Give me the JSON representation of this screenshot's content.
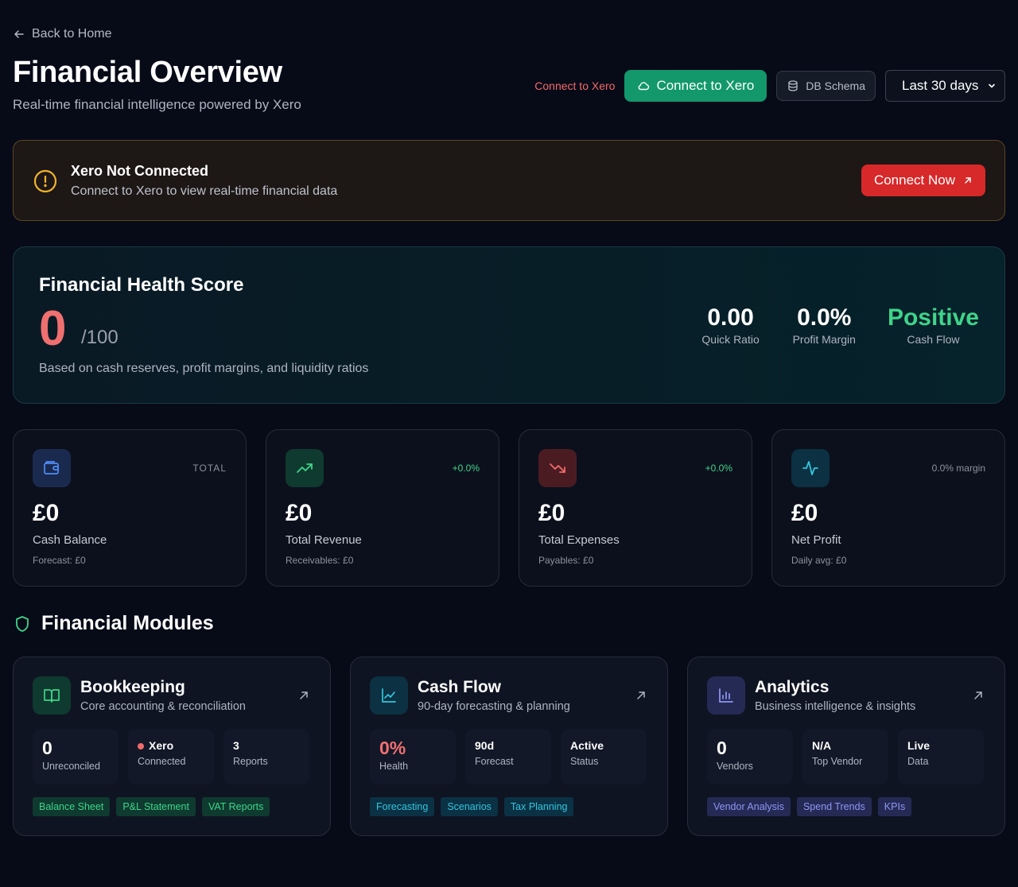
{
  "header": {
    "back_label": "Back to Home",
    "title": "Financial Overview",
    "subtitle": "Real-time financial intelligence powered by Xero",
    "connect_text": "Connect to Xero",
    "connect_button": "Connect to Xero",
    "schema_button": "DB Schema",
    "date_range": "Last 30 days"
  },
  "alert": {
    "title": "Xero Not Connected",
    "text": "Connect to Xero to view real-time financial data",
    "button": "Connect Now"
  },
  "health": {
    "title": "Financial Health Score",
    "score": "0",
    "max": "/100",
    "description": "Based on cash reserves, profit margins, and liquidity ratios",
    "metrics": [
      {
        "value": "0.00",
        "label": "Quick Ratio"
      },
      {
        "value": "0.0%",
        "label": "Profit Margin"
      },
      {
        "value": "Positive",
        "label": "Cash Flow"
      }
    ]
  },
  "stats": [
    {
      "tag": "TOTAL",
      "value": "£0",
      "label": "Cash Balance",
      "sub": "Forecast: £0"
    },
    {
      "tag": "+0.0%",
      "value": "£0",
      "label": "Total Revenue",
      "sub": "Receivables: £0"
    },
    {
      "tag": "+0.0%",
      "value": "£0",
      "label": "Total Expenses",
      "sub": "Payables: £0"
    },
    {
      "tag": "0.0% margin",
      "value": "£0",
      "label": "Net Profit",
      "sub": "Daily avg: £0"
    }
  ],
  "modules_heading": "Financial Modules",
  "modules": [
    {
      "title": "Bookkeeping",
      "desc": "Core accounting & reconciliation",
      "stats": [
        {
          "value": "0",
          "label": "Unreconciled"
        },
        {
          "value": "Xero",
          "label": "Connected"
        },
        {
          "value": "3",
          "label": "Reports"
        }
      ],
      "tags": [
        "Balance Sheet",
        "P&L Statement",
        "VAT Reports"
      ]
    },
    {
      "title": "Cash Flow",
      "desc": "90-day forecasting & planning",
      "stats": [
        {
          "value": "0%",
          "label": "Health"
        },
        {
          "value": "90d",
          "label": "Forecast"
        },
        {
          "value": "Active",
          "label": "Status"
        }
      ],
      "tags": [
        "Forecasting",
        "Scenarios",
        "Tax Planning"
      ]
    },
    {
      "title": "Analytics",
      "desc": "Business intelligence & insights",
      "stats": [
        {
          "value": "0",
          "label": "Vendors"
        },
        {
          "value": "N/A",
          "label": "Top Vendor"
        },
        {
          "value": "Live",
          "label": "Data"
        }
      ],
      "tags": [
        "Vendor Analysis",
        "Spend Trends",
        "KPIs"
      ]
    }
  ],
  "colors": {
    "background": "#070a17",
    "xero_green": "#12986b",
    "danger": "#d7282a",
    "score_red": "#f07070",
    "positive_green": "#3fd48a"
  }
}
